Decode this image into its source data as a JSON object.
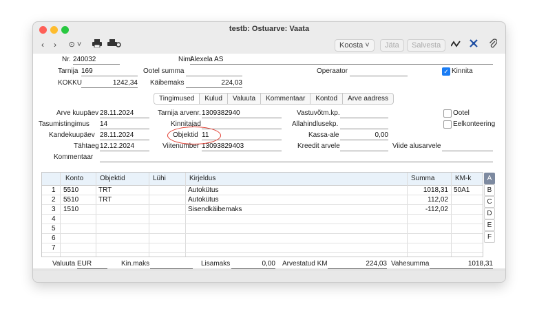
{
  "window": {
    "title": "testb: Ostuarve: Vaata"
  },
  "toolbar": {
    "nav_back": "‹",
    "nav_forward": "›",
    "more": "⊙ ˅",
    "koosta": "Koosta ˅",
    "jata": "Jäta",
    "salvesta": "Salvesta"
  },
  "header": {
    "nr_label": "Nr.",
    "nr_value": "240032",
    "nimi_label": "Nimi",
    "nimi_value": "Alexela AS",
    "tarnija_label": "Tarnija",
    "tarnija_value": "169",
    "ootel_summa_label": "Ootel summa",
    "ootel_summa_value": "",
    "operaator_label": "Operaator",
    "operaator_value": "",
    "kinnita_label": "Kinnita",
    "kokku_label": "KOKKU",
    "kokku_value": "1242,34",
    "kaibemaks_label": "Käibemaks",
    "kaibemaks_value": "224,03"
  },
  "tabs": [
    "Tingimused",
    "Kulud",
    "Valuuta",
    "Kommentaar",
    "Kontod",
    "Arve aadress"
  ],
  "terms": {
    "arve_kuupaev_label": "Arve kuupäev",
    "arve_kuupaev_value": "28.11.2024",
    "tarnija_arvenr_label": "Tarnija arvenr.",
    "tarnija_arvenr_value": "1309382940",
    "vastuvotm_label": "Vastuvõtm.kp.",
    "vastuvotm_value": "",
    "ootel_label": "Ootel",
    "tasumistingimus_label": "Tasumistingimus",
    "tasumistingimus_value": "14",
    "kinnitajad_label": "Kinnitajad",
    "kinnitajad_value": "",
    "allahindlusekp_label": "Allahindlusekp.",
    "allahindlusekp_value": "",
    "eelkonteering_label": "Eelkonteering",
    "kandekuupaev_label": "Kandekuupäev",
    "kandekuupaev_value": "28.11.2024",
    "objektid_label": "Objektid",
    "objektid_value": "11",
    "kassa_ale_label": "Kassa-ale",
    "kassa_ale_value": "0,00",
    "tahtaeg_label": "Tähtaeg",
    "tahtaeg_value": "12.12.2024",
    "viitenumber_label": "Viitenumber",
    "viitenumber_value": "13093829403",
    "kreedit_label": "Kreedit arvele",
    "kreedit_value": "",
    "viide_label": "Viide alusarvele",
    "viide_value": "",
    "kommentaar_label": "Kommentaar",
    "kommentaar_value": ""
  },
  "grid": {
    "columns": [
      "Konto",
      "Objektid",
      "Lühi",
      "Kirjeldus",
      "Summa",
      "KM-k"
    ],
    "rows": [
      {
        "n": "1",
        "konto": "5510",
        "objektid": "TRT",
        "luhi": "",
        "kirjeldus": "Autokütus",
        "summa": "1018,31",
        "kmk": "50A1"
      },
      {
        "n": "2",
        "konto": "5510",
        "objektid": "TRT",
        "luhi": "",
        "kirjeldus": "Autokütus",
        "summa": "112,02",
        "kmk": ""
      },
      {
        "n": "3",
        "konto": "1510",
        "objektid": "",
        "luhi": "",
        "kirjeldus": "Sisendkäibemaks",
        "summa": "-112,02",
        "kmk": ""
      },
      {
        "n": "4",
        "konto": "",
        "objektid": "",
        "luhi": "",
        "kirjeldus": "",
        "summa": "",
        "kmk": ""
      },
      {
        "n": "5",
        "konto": "",
        "objektid": "",
        "luhi": "",
        "kirjeldus": "",
        "summa": "",
        "kmk": ""
      },
      {
        "n": "6",
        "konto": "",
        "objektid": "",
        "luhi": "",
        "kirjeldus": "",
        "summa": "",
        "kmk": ""
      },
      {
        "n": "7",
        "konto": "",
        "objektid": "",
        "luhi": "",
        "kirjeldus": "",
        "summa": "",
        "kmk": ""
      }
    ],
    "side_tabs": [
      "A",
      "B",
      "C",
      "D",
      "E",
      "F"
    ]
  },
  "footer": {
    "valuuta_label": "Valuuta",
    "valuuta_value": "EUR",
    "kinmaks_label": "Kin.maks",
    "kinmaks_value": "",
    "lisamaks_label": "Lisamaks",
    "lisamaks_value": "0,00",
    "arvestatud_label": "Arvestatud KM",
    "arvestatud_value": "224,03",
    "vahesumma_label": "Vahesumma",
    "vahesumma_value": "1018,31"
  },
  "colors": {
    "accent": "#1a7cf4",
    "highlight": "#e23b2e",
    "grid_header": "#e9f2fa"
  }
}
